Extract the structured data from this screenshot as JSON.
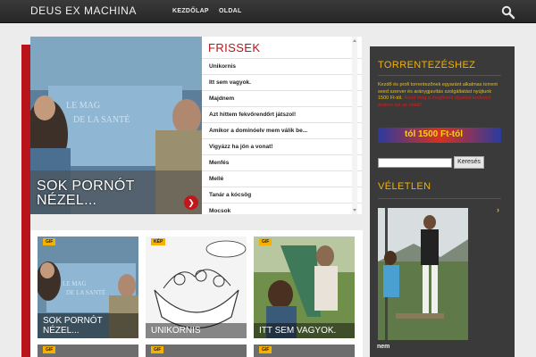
{
  "header": {
    "site_title": "DEUS EX MACHINA",
    "nav": [
      {
        "label": "KEZDŐLAP"
      },
      {
        "label": "OLDAL"
      }
    ]
  },
  "featured": {
    "title": "SOK PORNÓT NÉZEL...",
    "arrow": "❯"
  },
  "latest": {
    "heading": "FRISSEK",
    "items": [
      "Unikornis",
      "Itt sem vagyok.",
      "Majdnem",
      "Azt hittem fekvőrendőrt játszol!",
      "Amikor a dominóelv mem válik be...",
      "Vigyázz ha jön a vonat!",
      "Menfés",
      "Mellé",
      "Tanár a kócsög",
      "Mocsok"
    ]
  },
  "grid": {
    "cards": [
      {
        "badge": "GIF",
        "caption": "SOK PORNÓT NÉZEL..."
      },
      {
        "badge": "KÉP",
        "caption": "UNIKORNIS"
      },
      {
        "badge": "GIF",
        "caption": "ITT SEM VAGYOK."
      }
    ],
    "row2_badges": [
      "GIF",
      "GIF",
      "GIF"
    ]
  },
  "sidebar": {
    "torrent_title": "TORRENTEZÉSHEZ",
    "promo_text": "Kezdő és profi torrentezőnek egyaránt alkalmas torrent seed szerver és aránygjavítás szolgáltatást nyújtunk 1500 Ft-tól.",
    "promo_red": "Nézd meg a megfelelő díjakkal kedvező árakon ezt az oldalt!",
    "banner_text": "tól 1500 Ft-tól",
    "search_placeholder": "",
    "search_button": "Keresés",
    "random_title": "VÉLETLEN",
    "random_caption": "nem",
    "arrow": "›"
  },
  "colors": {
    "accent_red": "#b8141a",
    "sidebar_yellow": "#f5b100",
    "dark_bg": "#3a3a3a"
  }
}
